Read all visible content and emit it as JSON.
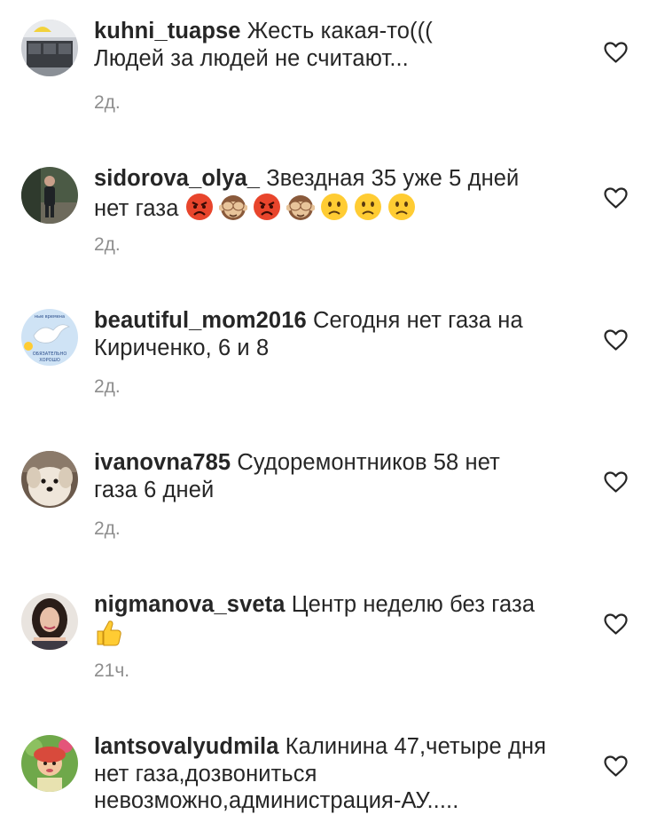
{
  "comments": [
    {
      "username": "kuhni_tuapse",
      "text": "Жесть какая-то(((",
      "text2": "Людей за людей не считают...",
      "time": "2д."
    },
    {
      "username": "sidorova_olya_",
      "text": "Звездная 35 уже 5 дней",
      "text2": "нет газа",
      "emoji": [
        "angry-face",
        "see-no-evil-monkey",
        "angry-face",
        "see-no-evil-monkey",
        "slightly-frowning-face",
        "slightly-frowning-face",
        "slightly-frowning-face"
      ],
      "time": "2д."
    },
    {
      "username": "beautiful_mom2016",
      "text": "Сегодня нет газа на",
      "text2": "Кириченко, 6 и 8",
      "avatar_text": "...ные времена проходят... ОБЯЗАТЕЛЬНО ВСЁ БУДЕТ ХОРОШО",
      "time": "2д."
    },
    {
      "username": "ivanovna785",
      "text": "Судоремонтников 58 нет",
      "text2": "газа 6 дней",
      "time": "2д."
    },
    {
      "username": "nigmanova_sveta",
      "text": "Центр неделю без газа",
      "emoji": [
        "thumbs-up"
      ],
      "time": "21ч."
    },
    {
      "username": "lantsovalyudmila",
      "text": "Калинина 47,четыре дня",
      "text2": "нет газа,дозвониться",
      "text3": "невозможно,администрация-АУ....."
    }
  ],
  "colors": {
    "text": "#262626",
    "muted": "#8e8e8e",
    "emoji_yellow": "#ffcc33",
    "emoji_red": "#e8452c"
  }
}
